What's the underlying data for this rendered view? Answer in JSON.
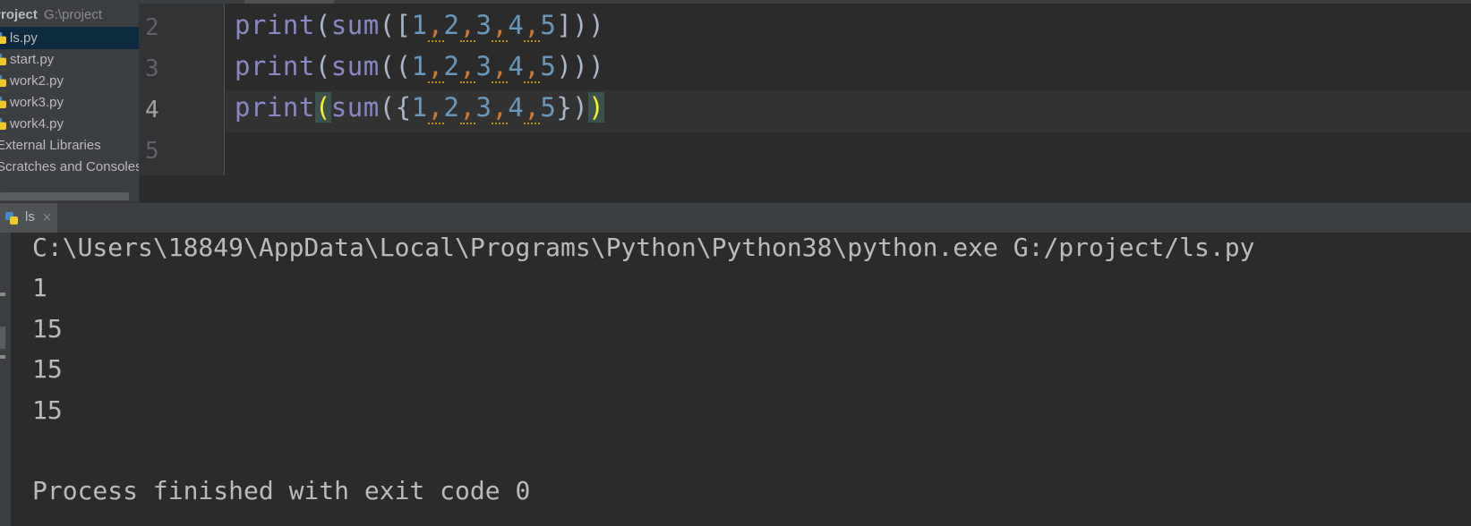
{
  "project": {
    "header_title": "Project",
    "header_path": "G:\\project",
    "files": [
      {
        "label": "ls.py",
        "selected": true
      },
      {
        "label": "start.py",
        "selected": false
      },
      {
        "label": "work2.py",
        "selected": false
      },
      {
        "label": "work3.py",
        "selected": false
      },
      {
        "label": "work4.py",
        "selected": false
      }
    ],
    "nodes": [
      "External Libraries",
      "Scratches and Consoles"
    ]
  },
  "editor": {
    "line_numbers": [
      "2",
      "3",
      "4",
      "5"
    ],
    "current_line": "4",
    "lines": [
      {
        "fn1": "print",
        "op1": "(",
        "fn2": "sum",
        "op2": "(",
        "open": "[",
        "n1": "1",
        "n2": "2",
        "n3": "3",
        "n4": "4",
        "n5": "5",
        "close": "]",
        "cp2": ")",
        "cp1": ")"
      },
      {
        "fn1": "print",
        "op1": "(",
        "fn2": "sum",
        "op2": "(",
        "open": "(",
        "n1": "1",
        "n2": "2",
        "n3": "3",
        "n4": "4",
        "n5": "5",
        "close": ")",
        "cp2": ")",
        "cp1": ")"
      },
      {
        "fn1": "print",
        "op1": "(",
        "fn2": "sum",
        "op2": "(",
        "open": "{",
        "n1": "1",
        "n2": "2",
        "n3": "3",
        "n4": "4",
        "n5": "5",
        "close": "}",
        "cp2": ")",
        "cp1": ")"
      }
    ],
    "comma": ","
  },
  "run": {
    "tab_label": "ls",
    "close_glyph": "×",
    "console": [
      "C:\\Users\\18849\\AppData\\Local\\Programs\\Python\\Python38\\python.exe G:/project/ls.py",
      "1",
      "15",
      "15",
      "15",
      "",
      "Process finished with exit code 0"
    ]
  },
  "colors": {
    "editor_bg": "#2b2b2b",
    "panel_bg": "#3c3f41",
    "selection": "#0d293e",
    "builtin": "#8888c6",
    "number": "#6897bb",
    "comma": "#cc7832",
    "brace_match": "#ffef28"
  },
  "icons": [
    "python-file-icon",
    "close-icon"
  ]
}
